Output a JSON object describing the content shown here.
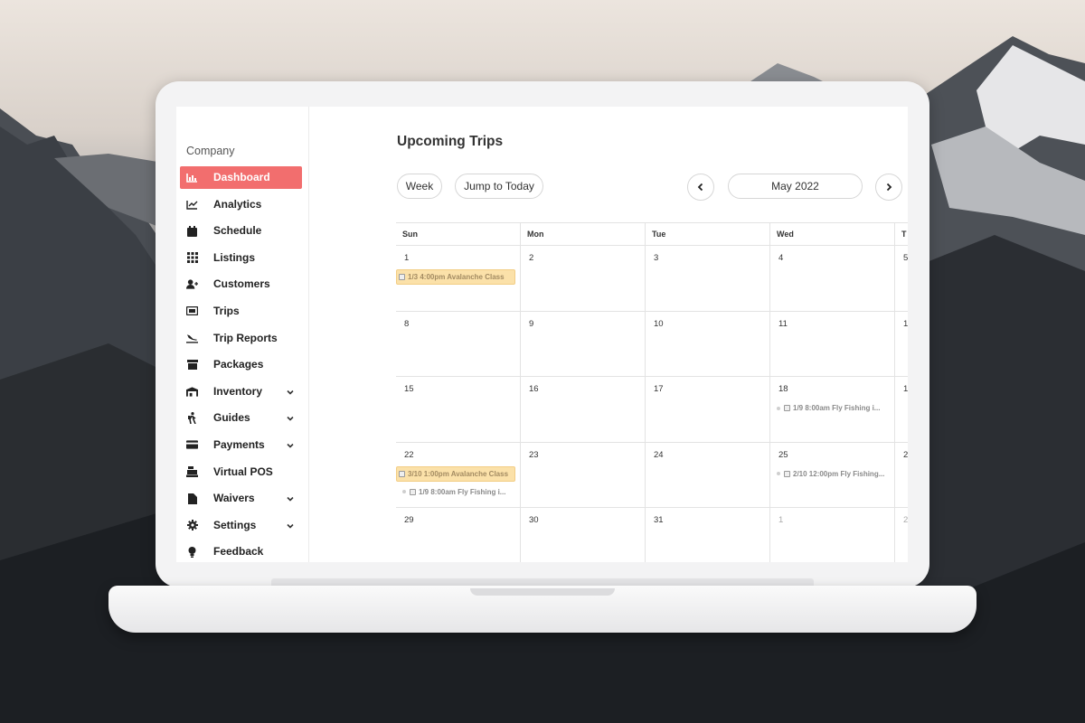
{
  "sidebar": {
    "company": "Company",
    "items": [
      {
        "label": "Dashboard",
        "icon": "dashboard-icon",
        "active": true,
        "expandable": false
      },
      {
        "label": "Analytics",
        "icon": "analytics-icon",
        "active": false,
        "expandable": false
      },
      {
        "label": "Schedule",
        "icon": "calendar-icon",
        "active": false,
        "expandable": false
      },
      {
        "label": "Listings",
        "icon": "grid-icon",
        "active": false,
        "expandable": false
      },
      {
        "label": "Customers",
        "icon": "users-icon",
        "active": false,
        "expandable": false
      },
      {
        "label": "Trips",
        "icon": "ticket-icon",
        "active": false,
        "expandable": false
      },
      {
        "label": "Trip Reports",
        "icon": "plane-arrival-icon",
        "active": false,
        "expandable": false
      },
      {
        "label": "Packages",
        "icon": "box-icon",
        "active": false,
        "expandable": false
      },
      {
        "label": "Inventory",
        "icon": "warehouse-icon",
        "active": false,
        "expandable": true
      },
      {
        "label": "Guides",
        "icon": "hiker-icon",
        "active": false,
        "expandable": true
      },
      {
        "label": "Payments",
        "icon": "credit-card-icon",
        "active": false,
        "expandable": true
      },
      {
        "label": "Virtual POS",
        "icon": "cash-register-icon",
        "active": false,
        "expandable": false
      },
      {
        "label": "Waivers",
        "icon": "document-icon",
        "active": false,
        "expandable": true
      },
      {
        "label": "Settings",
        "icon": "gear-icon",
        "active": false,
        "expandable": true
      },
      {
        "label": "Feedback",
        "icon": "lightbulb-icon",
        "active": false,
        "expandable": false
      }
    ]
  },
  "main": {
    "title": "Upcoming Trips",
    "week_label": "Week",
    "today_label": "Jump to Today",
    "month_label": "May 2022"
  },
  "calendar": {
    "headers": [
      "Sun",
      "Mon",
      "Tue",
      "Wed",
      "T"
    ],
    "weeks": [
      [
        {
          "day": "1",
          "muted": false,
          "events": [
            {
              "text": "1/3 4:00pm Avalanche Class",
              "style": "hl"
            }
          ]
        },
        {
          "day": "2",
          "muted": false,
          "events": []
        },
        {
          "day": "3",
          "muted": false,
          "events": []
        },
        {
          "day": "4",
          "muted": false,
          "events": []
        },
        {
          "day": "5",
          "muted": false,
          "events": []
        }
      ],
      [
        {
          "day": "8",
          "muted": false,
          "events": []
        },
        {
          "day": "9",
          "muted": false,
          "events": []
        },
        {
          "day": "10",
          "muted": false,
          "events": []
        },
        {
          "day": "11",
          "muted": false,
          "events": []
        },
        {
          "day": "1",
          "muted": false,
          "events": []
        }
      ],
      [
        {
          "day": "15",
          "muted": false,
          "events": []
        },
        {
          "day": "16",
          "muted": false,
          "events": []
        },
        {
          "day": "17",
          "muted": false,
          "events": []
        },
        {
          "day": "18",
          "muted": false,
          "events": [
            {
              "text": "1/9 8:00am Fly Fishing i...",
              "style": "plain"
            }
          ]
        },
        {
          "day": "1",
          "muted": false,
          "events": []
        }
      ],
      [
        {
          "day": "22",
          "muted": false,
          "events": [
            {
              "text": "3/10 1:00pm Avalanche Class",
              "style": "hl"
            },
            {
              "text": "1/9 8:00am Fly Fishing i...",
              "style": "plain"
            }
          ]
        },
        {
          "day": "23",
          "muted": false,
          "events": []
        },
        {
          "day": "24",
          "muted": false,
          "events": []
        },
        {
          "day": "25",
          "muted": false,
          "events": [
            {
              "text": "2/10 12:00pm Fly Fishing...",
              "style": "plain"
            }
          ]
        },
        {
          "day": "2",
          "muted": false,
          "events": []
        }
      ],
      [
        {
          "day": "29",
          "muted": false,
          "events": []
        },
        {
          "day": "30",
          "muted": false,
          "events": []
        },
        {
          "day": "31",
          "muted": false,
          "events": []
        },
        {
          "day": "1",
          "muted": true,
          "events": []
        },
        {
          "day": "2",
          "muted": true,
          "events": []
        }
      ]
    ]
  },
  "colors": {
    "accent": "#f26e6e",
    "event_bg": "#fbe1a9",
    "event_border": "#f2cd84"
  }
}
